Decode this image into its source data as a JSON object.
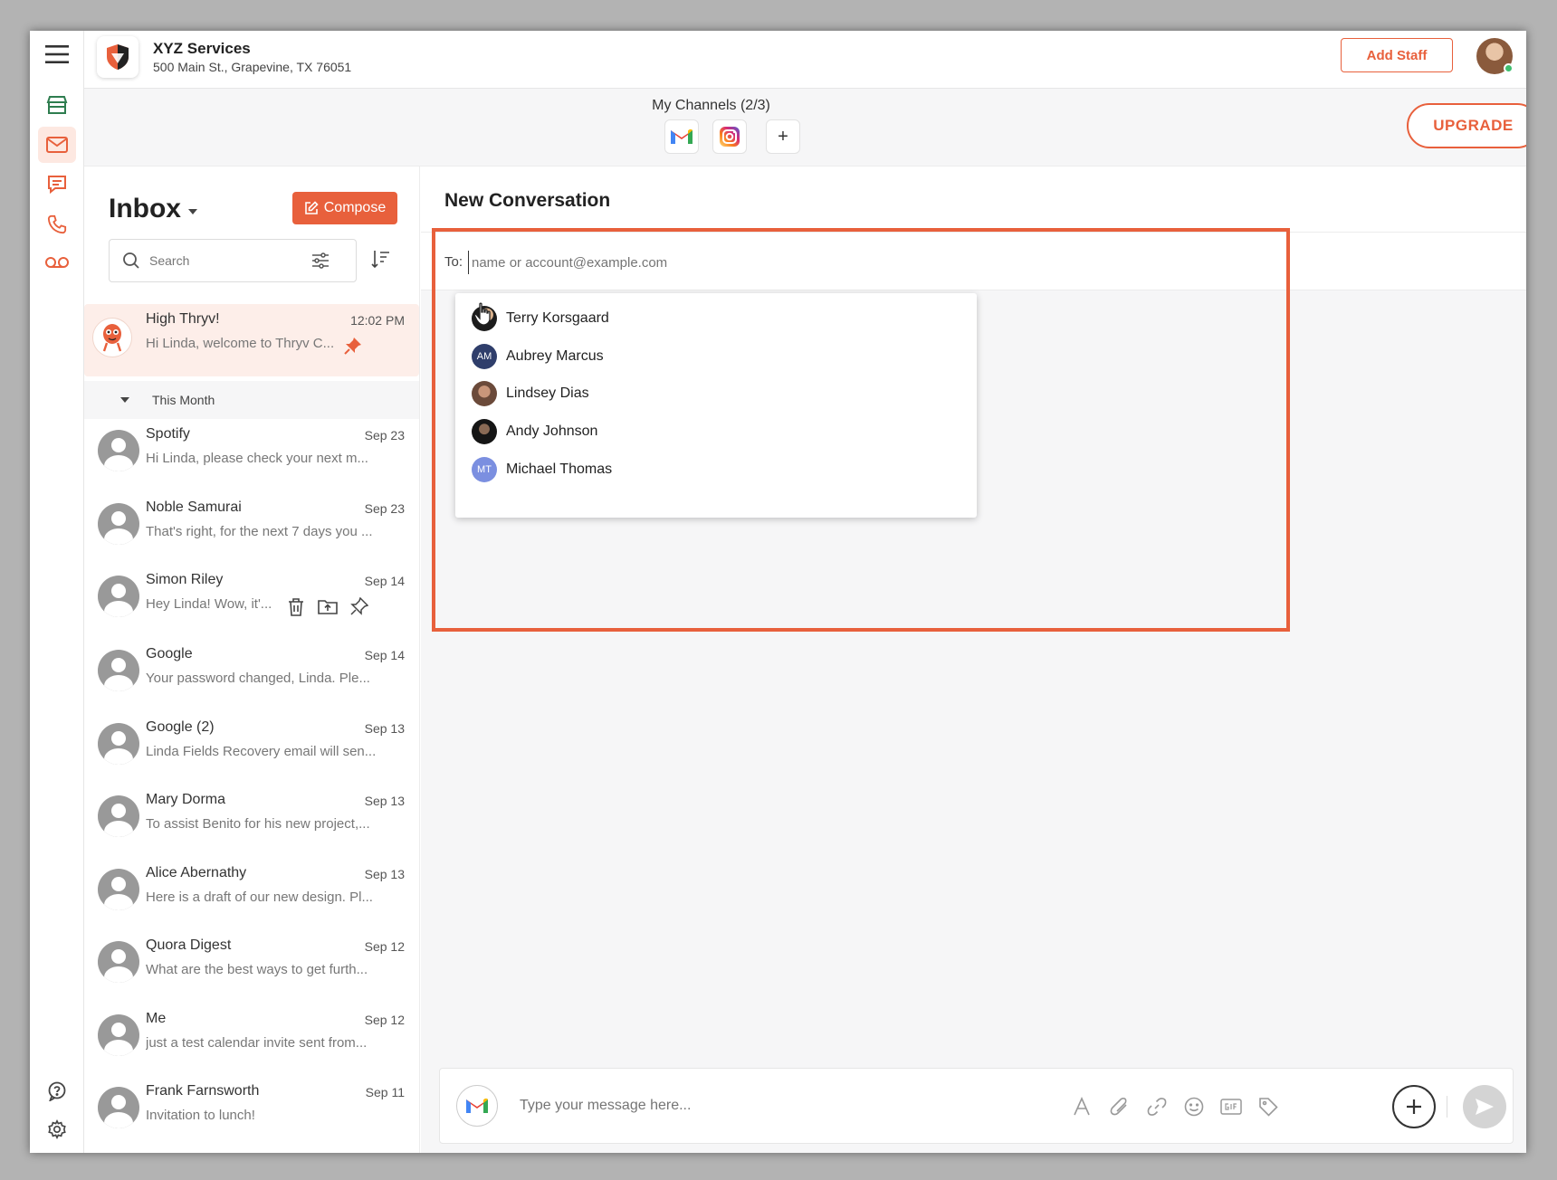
{
  "business": {
    "name": "XYZ Services",
    "address": "500 Main St., Grapevine, TX 76051"
  },
  "header": {
    "add_staff_label": "Add Staff"
  },
  "channels": {
    "title": "My Channels (2/3)",
    "add_label": "+",
    "upgrade_label": "UPGRADE",
    "items": [
      "gmail-icon",
      "instagram-icon"
    ]
  },
  "inbox": {
    "title": "Inbox",
    "compose_label": "Compose",
    "search_placeholder": "Search",
    "pinned": {
      "name": "High Thryv!",
      "date": "12:02 PM",
      "preview": "Hi Linda, welcome to Thryv C..."
    },
    "section_label": "This Month",
    "messages": [
      {
        "name": "Spotify",
        "date": "Sep 23",
        "preview": "Hi Linda, please check your next m..."
      },
      {
        "name": "Noble Samurai",
        "date": "Sep 23",
        "preview": "That's right, for the next 7 days you ..."
      },
      {
        "name": "Simon Riley",
        "date": "Sep 14",
        "preview": "Hey Linda! Wow, it'..."
      },
      {
        "name": "Google",
        "date": "Sep 14",
        "preview": "Your password changed, Linda. Ple..."
      },
      {
        "name": "Google (2)",
        "date": "Sep 13",
        "preview": "Linda Fields Recovery email will sen..."
      },
      {
        "name": "Mary Dorma",
        "date": "Sep 13",
        "preview": "To assist Benito for his new project,..."
      },
      {
        "name": "Alice Abernathy",
        "date": "Sep 13",
        "preview": "Here is a draft of our new design. Pl..."
      },
      {
        "name": "Quora Digest",
        "date": "Sep 12",
        "preview": "What are the best ways to get furth..."
      },
      {
        "name": "Me",
        "date": "Sep 12",
        "preview": "just a test calendar invite sent from..."
      },
      {
        "name": "Frank Farnsworth",
        "date": "Sep 11",
        "preview": "Invitation to lunch!"
      }
    ]
  },
  "conversation": {
    "title": "New Conversation",
    "to_label": "To:",
    "to_placeholder": "name or account@example.com",
    "suggestions": [
      {
        "name": "Terry Korsgaard",
        "initials": ""
      },
      {
        "name": "Aubrey Marcus",
        "initials": "AM"
      },
      {
        "name": "Lindsey Dias",
        "initials": ""
      },
      {
        "name": "Andy Johnson",
        "initials": ""
      },
      {
        "name": "Michael Thomas",
        "initials": "MT"
      }
    ],
    "composer_placeholder": "Type your message here..."
  },
  "colors": {
    "accent": "#e8603c",
    "pinned_bg": "#fdeee9",
    "rail_icon": "#e8603c",
    "store_icon": "#2e7d4f",
    "avatar_am": "#2f3e6b",
    "avatar_mt": "#7b8fe0"
  }
}
